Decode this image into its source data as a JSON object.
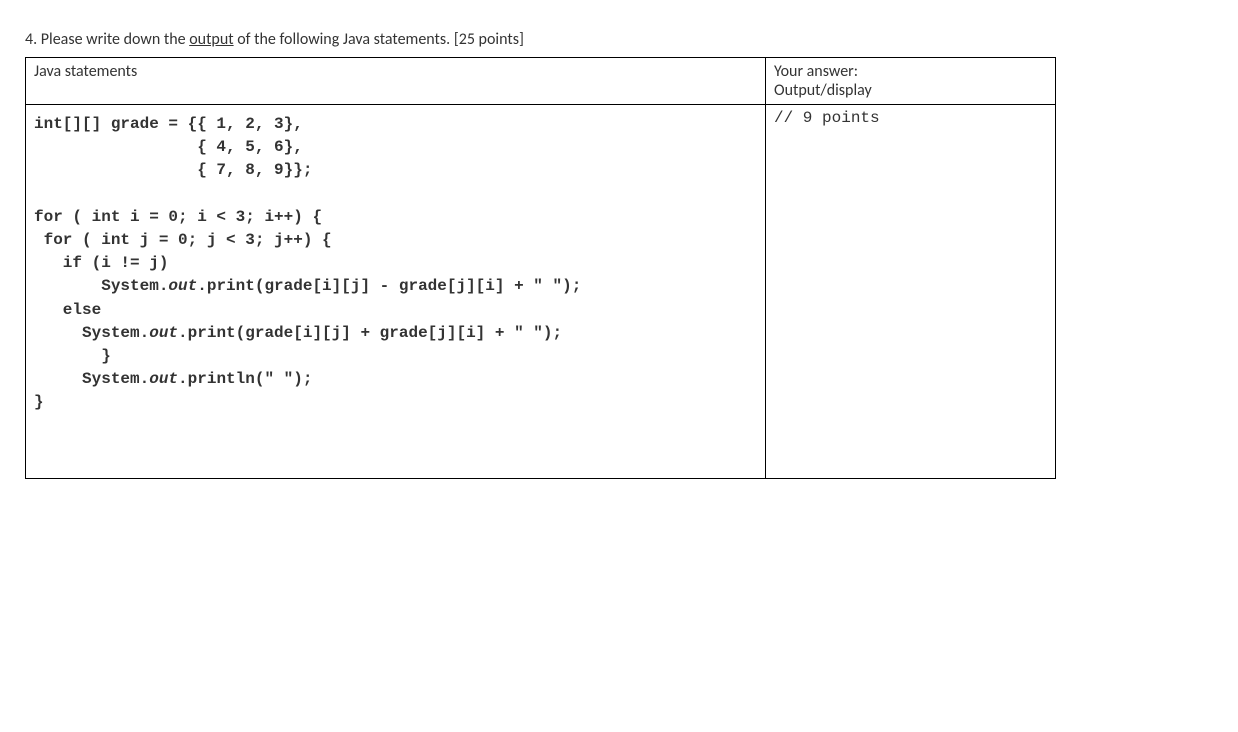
{
  "question": {
    "number": "4.",
    "prompt_before": "Please write down the ",
    "prompt_underlined": "output",
    "prompt_after": " of the following Java statements. [25 points]"
  },
  "table": {
    "header_left": "Java statements",
    "header_right_line1": "Your answer:",
    "header_right_line2": "Output/display",
    "answer_note": "// 9 points",
    "code_lines": [
      "int[][] grade = {{ 1, 2, 3},",
      "                 { 4, 5, 6},",
      "                 { 7, 8, 9}};",
      "",
      "for ( int i = 0; i < 3; i++) {",
      " for ( int j = 0; j < 3; j++) {",
      "   if (i != j)",
      "       System.out.print(grade[i][j] - grade[j][i] + \" \");",
      "   else",
      "     System.out.print(grade[i][j] + grade[j][i] + \" \");",
      "       }",
      "     System.out.println(\" \");",
      "}"
    ]
  }
}
